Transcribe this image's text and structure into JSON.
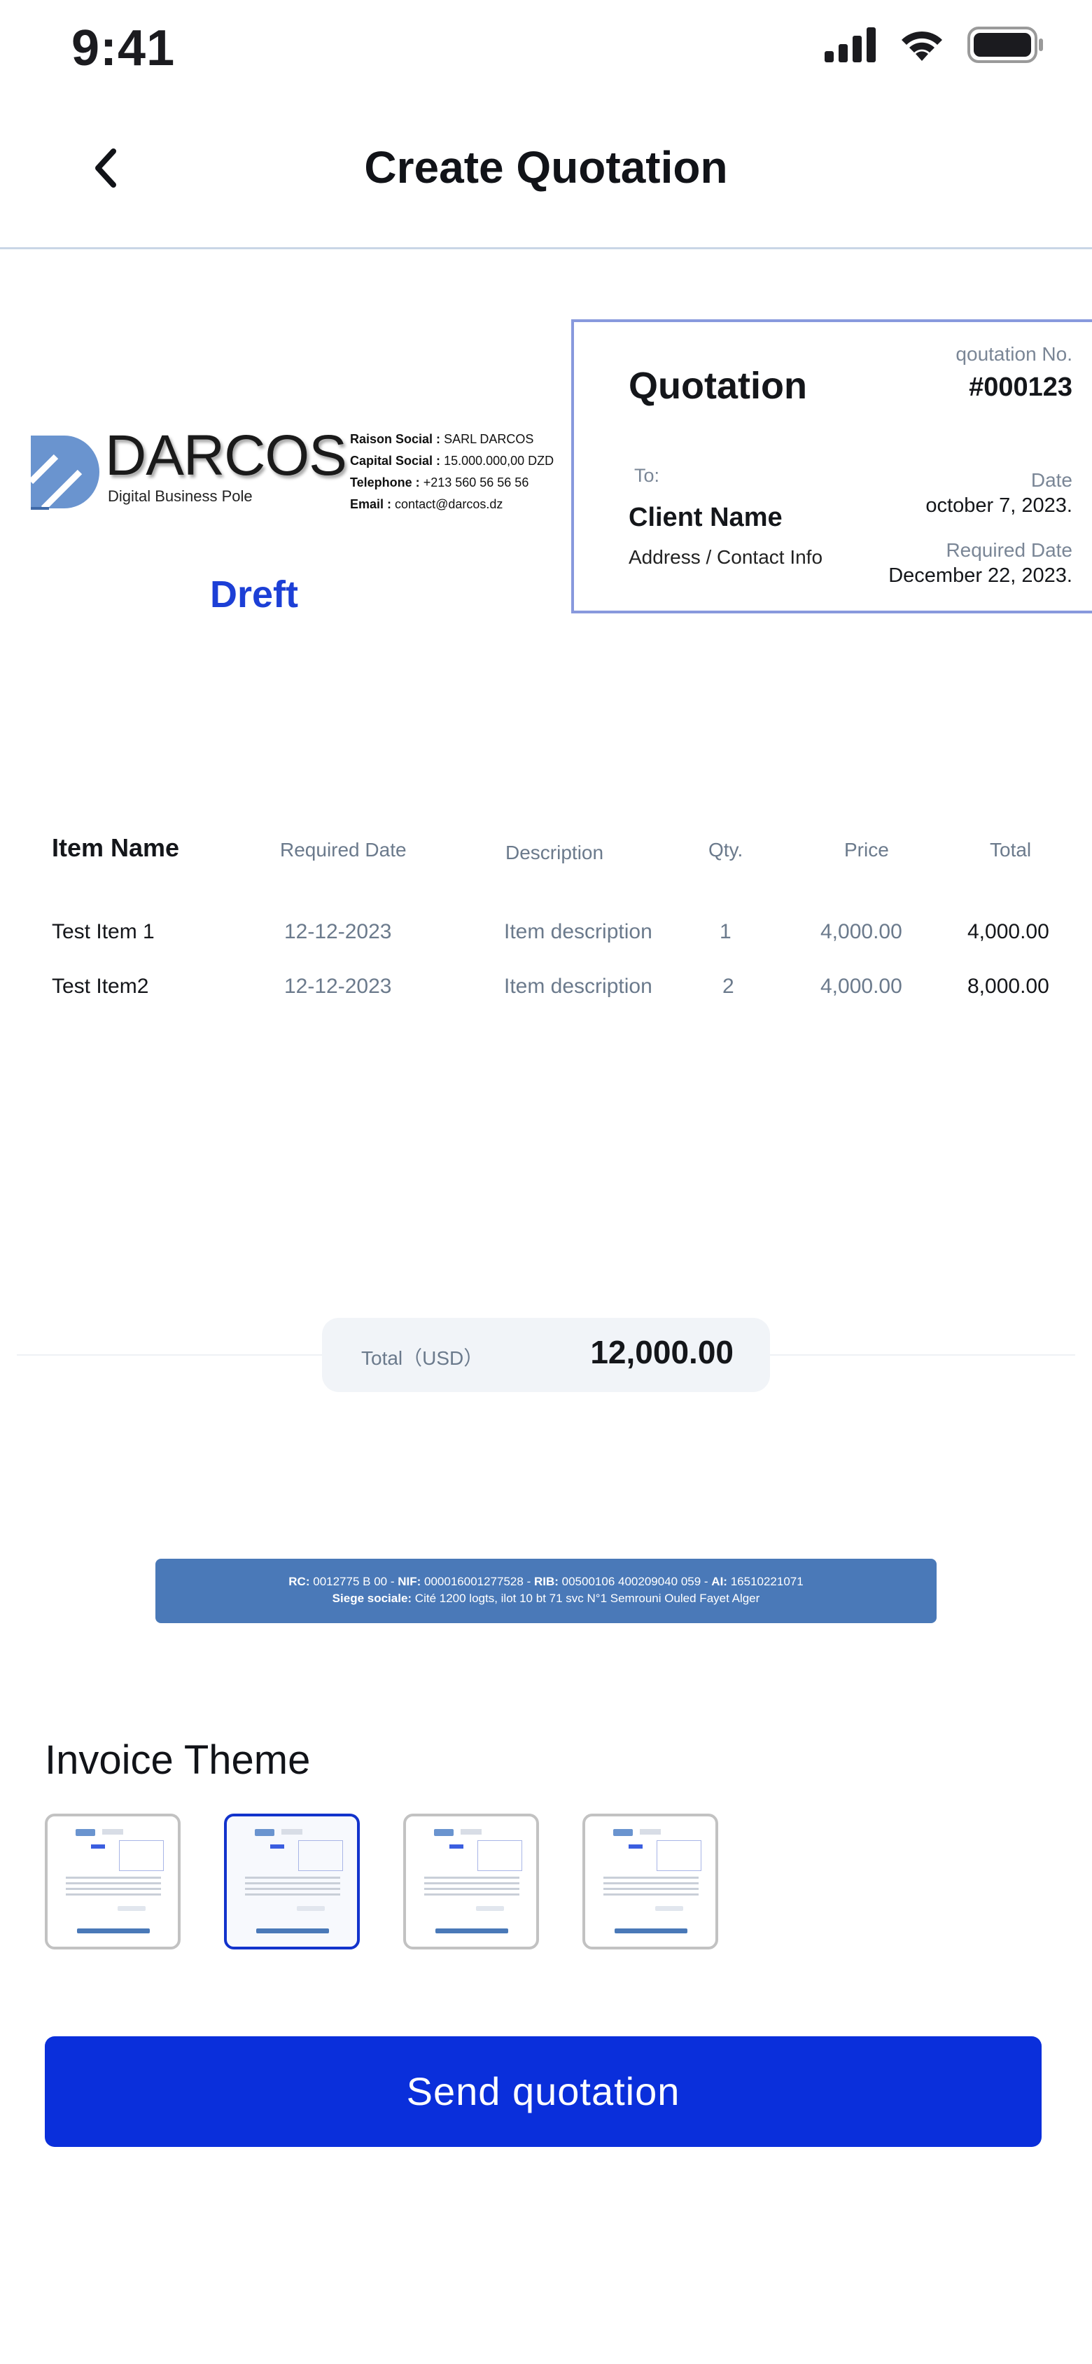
{
  "status_bar": {
    "time": "9:41",
    "icons": [
      "signal-icon",
      "wifi-icon",
      "battery-icon"
    ]
  },
  "header": {
    "title": "Create Quotation",
    "back_icon": "chevron-left-icon"
  },
  "company": {
    "logo_text": "DARCOS",
    "logo_subtitle": "Digital Business Pole",
    "raison_social_label": "Raison Social :",
    "raison_social": "SARL DARCOS",
    "capital_label": "Capital Social :",
    "capital": "15.000.000,00 DZD",
    "telephone_label": "Telephone :",
    "telephone": "+213 560 56 56 56",
    "email_label": "Email :",
    "email": "contact@darcos.dz"
  },
  "document_status": "Dreft",
  "quotation": {
    "title": "Quotation",
    "number_label": "qoutation No.",
    "number": "#000123",
    "to_label": "To:",
    "client_name": "Client Name",
    "client_address": "Address / Contact Info",
    "date_label": "Date",
    "date": "october 7, 2023.",
    "required_date_label": "Required Date",
    "required_date": "December 22, 2023."
  },
  "items": {
    "headers": [
      "Item Name",
      "Required Date",
      "Description",
      "Qty.",
      "Price",
      "Total"
    ],
    "rows": [
      [
        "Test Item 1",
        "12-12-2023",
        "Item description",
        "1",
        "4,000.00",
        "4,000.00"
      ],
      [
        "Test Item2",
        "12-12-2023",
        "Item description",
        "2",
        "4,000.00",
        "8,000.00"
      ]
    ]
  },
  "total": {
    "label": "Total（USD）",
    "value": "12,000.00"
  },
  "footer": {
    "rc_label": "RC:",
    "rc": "0012775 B 00",
    "nif_label": "NIF:",
    "nif": "000016001277528",
    "rib_label": "RIB:",
    "rib": "00500106 400209040 059",
    "ai_label": "AI:",
    "ai": "16510221071",
    "siege_label": "Siege sociale:",
    "siege": "Cité 1200 logts, ilot 10 bt 71 svc N°1 Semrouni Ouled Fayet Alger"
  },
  "theme": {
    "title": "Invoice Theme",
    "options": 4,
    "selected_index": 1
  },
  "actions": {
    "send_label": "Send quotation"
  },
  "colors": {
    "primary": "#0a2fdb",
    "status_label": "#1c3fd6",
    "footer_band": "#4a79b8",
    "quote_border": "#8899dd",
    "logo_blue": "#6a94cf"
  }
}
